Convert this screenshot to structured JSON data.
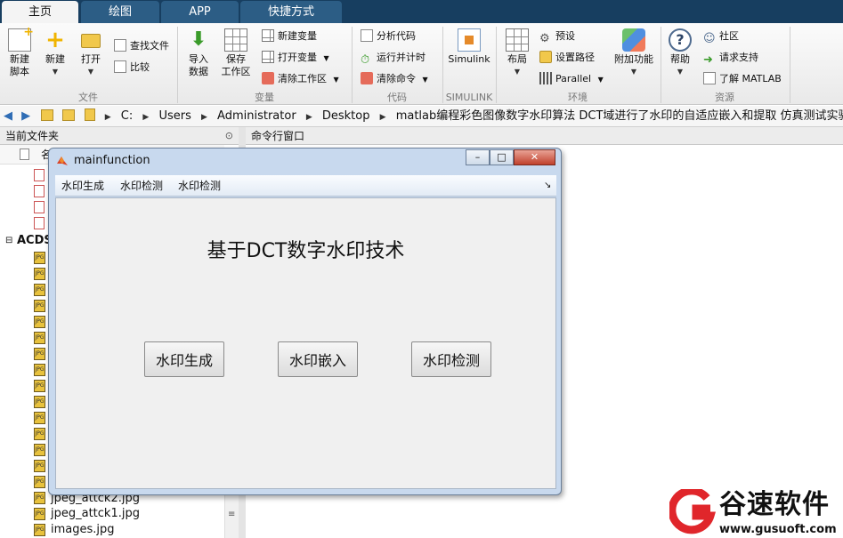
{
  "tabs": [
    {
      "label": "主页",
      "active": true
    },
    {
      "label": "绘图",
      "active": false
    },
    {
      "label": "APP",
      "active": false
    },
    {
      "label": "快捷方式",
      "active": false
    }
  ],
  "ribbon": {
    "file": {
      "group_label": "文件",
      "new_script": "新建\n脚本",
      "new": "新建",
      "open": "打开",
      "find_files": "查找文件",
      "compare": "比较"
    },
    "variable": {
      "group_label": "变量",
      "import_data": "导入\n数据",
      "save_workspace": "保存\n工作区",
      "new_variable": "新建变量",
      "open_variable": "打开变量",
      "clear_workspace": "清除工作区"
    },
    "code": {
      "group_label": "代码",
      "analyze_code": "分析代码",
      "run_and_time": "运行并计时",
      "clear_commands": "清除命令"
    },
    "simulink": {
      "group_label": "SIMULINK",
      "simulink": "Simulink"
    },
    "environment": {
      "group_label": "环境",
      "layout": "布局",
      "preferences": "预设",
      "set_path": "设置路径",
      "parallel": "Parallel",
      "addons": "附加功能"
    },
    "resources": {
      "group_label": "资源",
      "help": "帮助",
      "community": "社区",
      "request_support": "请求支持",
      "learn_matlab": "了解 MATLAB"
    }
  },
  "address": {
    "crumbs": [
      "C:",
      "Users",
      "Administrator",
      "Desktop",
      "matlab编程彩色图像数字水印算法 DCT域进行了水印的自适应嵌入和提取 仿真测试实验源码程序+文章"
    ]
  },
  "panels": {
    "current_folder": "当前文件夹",
    "command_window": "命令行窗口",
    "name_column": "名",
    "folder_entry": "ACDS",
    "files": [
      "jpeg_attck2.jpg",
      "jpeg_attck1.jpg",
      "images.jpg"
    ],
    "jpg_badge": "JPG"
  },
  "dialog": {
    "title": "mainfunction",
    "menu": [
      "水印生成",
      "水印检测",
      "水印检测"
    ],
    "heading": "基于DCT数字水印技术",
    "buttons": [
      "水印生成",
      "水印嵌入",
      "水印检测"
    ],
    "close_glyph": "✕",
    "min_glyph": "–",
    "max_glyph": "□"
  },
  "watermark": {
    "name": "谷速软件",
    "url": "www.gusuoft.com"
  },
  "colors": {
    "tabbar": "#173e60",
    "tab_inactive": "#2c5d85",
    "dialog_frame": "#c8d9ee",
    "watermark_red": "#e0262b"
  }
}
